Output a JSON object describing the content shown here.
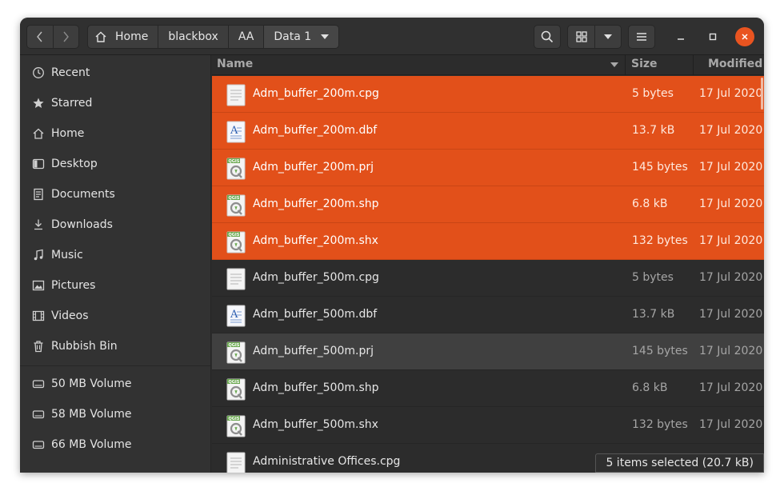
{
  "header": {
    "breadcrumbs": [
      "Home",
      "blackbox",
      "AA",
      "Data 1"
    ]
  },
  "sidebar": {
    "places": [
      {
        "label": "Recent",
        "icon": "clock-icon"
      },
      {
        "label": "Starred",
        "icon": "star-icon"
      },
      {
        "label": "Home",
        "icon": "home-icon"
      },
      {
        "label": "Desktop",
        "icon": "desktop-icon"
      },
      {
        "label": "Documents",
        "icon": "document-icon"
      },
      {
        "label": "Downloads",
        "icon": "download-icon"
      },
      {
        "label": "Music",
        "icon": "music-icon"
      },
      {
        "label": "Pictures",
        "icon": "picture-icon"
      },
      {
        "label": "Videos",
        "icon": "video-icon"
      },
      {
        "label": "Rubbish Bin",
        "icon": "trash-icon"
      }
    ],
    "volumes": [
      {
        "label": "50 MB Volume",
        "icon": "drive-icon"
      },
      {
        "label": "58 MB Volume",
        "icon": "drive-icon"
      },
      {
        "label": "66 MB Volume",
        "icon": "drive-icon"
      }
    ]
  },
  "columns": {
    "name": "Name",
    "size": "Size",
    "modified": "Modified"
  },
  "files": [
    {
      "name": "Adm_buffer_200m.cpg",
      "size": "5 bytes",
      "modified": "17 Jul 2020",
      "type": "text",
      "selected": true
    },
    {
      "name": "Adm_buffer_200m.dbf",
      "size": "13.7 kB",
      "modified": "17 Jul 2020",
      "type": "dbf",
      "selected": true
    },
    {
      "name": "Adm_buffer_200m.prj",
      "size": "145 bytes",
      "modified": "17 Jul 2020",
      "type": "qgis",
      "selected": true
    },
    {
      "name": "Adm_buffer_200m.shp",
      "size": "6.8 kB",
      "modified": "17 Jul 2020",
      "type": "qgis",
      "selected": true
    },
    {
      "name": "Adm_buffer_200m.shx",
      "size": "132 bytes",
      "modified": "17 Jul 2020",
      "type": "qgis",
      "selected": true
    },
    {
      "name": "Adm_buffer_500m.cpg",
      "size": "5 bytes",
      "modified": "17 Jul 2020",
      "type": "text",
      "selected": false
    },
    {
      "name": "Adm_buffer_500m.dbf",
      "size": "13.7 kB",
      "modified": "17 Jul 2020",
      "type": "dbf",
      "selected": false
    },
    {
      "name": "Adm_buffer_500m.prj",
      "size": "145 bytes",
      "modified": "17 Jul 2020",
      "type": "qgis",
      "selected": false,
      "hover": true
    },
    {
      "name": "Adm_buffer_500m.shp",
      "size": "6.8 kB",
      "modified": "17 Jul 2020",
      "type": "qgis",
      "selected": false
    },
    {
      "name": "Adm_buffer_500m.shx",
      "size": "132 bytes",
      "modified": "17 Jul 2020",
      "type": "qgis",
      "selected": false
    },
    {
      "name": "Administrative Offices.cpg",
      "size": "",
      "modified": "",
      "type": "text",
      "selected": false
    }
  ],
  "status": "5 items selected  (20.7 kB)",
  "colors": {
    "selection": "#e2501a",
    "close_button": "#e95420",
    "window_bg": "#2c2c2c"
  }
}
